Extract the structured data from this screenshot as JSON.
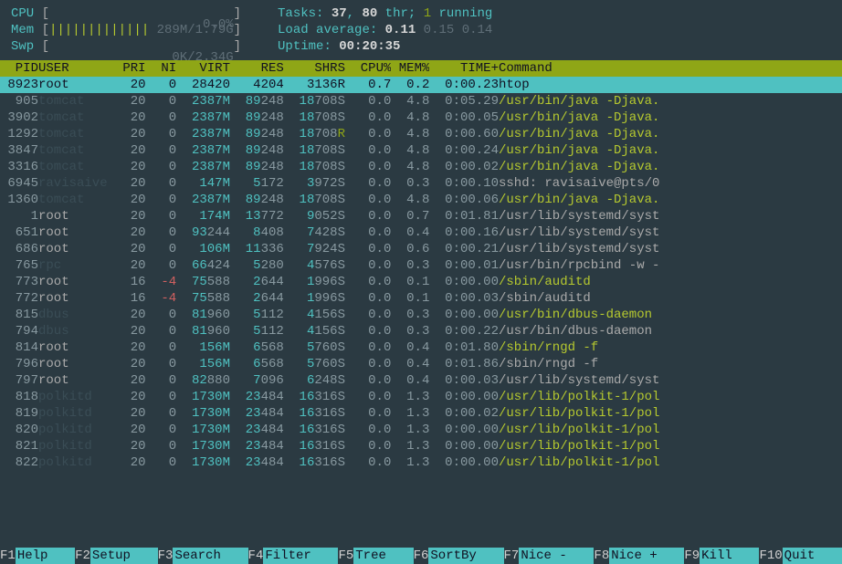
{
  "meters": {
    "cpu": {
      "label": "CPU",
      "bar": "",
      "value": "0.0%"
    },
    "mem": {
      "label": "Mem",
      "bar": "|||||||||||||",
      "value": "289M/1.79G"
    },
    "swp": {
      "label": "Swp",
      "bar": "",
      "value": "0K/2.34G"
    }
  },
  "summary": {
    "tasks_label": "Tasks: ",
    "tasks_n": "37",
    "tasks_sep": ", ",
    "thr_n": "80",
    "thr_suffix": " thr; ",
    "running_n": "1",
    "running_suffix": " running",
    "load_label": "Load average: ",
    "load1": "0.11",
    "load5": "0.15",
    "load15": "0.14",
    "uptime_label": "Uptime: ",
    "uptime": "00:20:35"
  },
  "columns": [
    "PID",
    "USER",
    "PRI",
    "NI",
    "VIRT",
    "RES",
    "SHR",
    "S",
    "CPU%",
    "MEM%",
    "TIME+",
    "Command"
  ],
  "rows": [
    {
      "sel": true,
      "pid": "8923",
      "user": "root",
      "ucol": "root",
      "pri": "20",
      "ni": "0",
      "virt": "28420",
      "res": "4204",
      "shr": "3136",
      "s": "R",
      "cpu": "0.7",
      "mem": "0.2",
      "time": "0:00.23",
      "cmd": "htop",
      "cstyle": "std"
    },
    {
      "pid": "905",
      "user": "tomcat",
      "ucol": "other",
      "pri": "20",
      "ni": "0",
      "virt": "2387M",
      "res": "89248",
      "shr": "18708",
      "s": "S",
      "cpu": "0.0",
      "mem": "4.8",
      "time": "0:05.29",
      "cmd": "/usr/bin/java -Djava.",
      "cstyle": "green"
    },
    {
      "pid": "3902",
      "user": "tomcat",
      "ucol": "other",
      "pri": "20",
      "ni": "0",
      "virt": "2387M",
      "res": "89248",
      "shr": "18708",
      "s": "S",
      "cpu": "0.0",
      "mem": "4.8",
      "time": "0:00.05",
      "cmd": "/usr/bin/java -Djava.",
      "cstyle": "green"
    },
    {
      "pid": "1292",
      "user": "tomcat",
      "ucol": "other",
      "pri": "20",
      "ni": "0",
      "virt": "2387M",
      "res": "89248",
      "shr": "18708",
      "s": "R",
      "cpu": "0.0",
      "mem": "4.8",
      "time": "0:00.60",
      "cmd": "/usr/bin/java -Djava.",
      "cstyle": "green",
      "sflag": "green"
    },
    {
      "pid": "3847",
      "user": "tomcat",
      "ucol": "other",
      "pri": "20",
      "ni": "0",
      "virt": "2387M",
      "res": "89248",
      "shr": "18708",
      "s": "S",
      "cpu": "0.0",
      "mem": "4.8",
      "time": "0:00.24",
      "cmd": "/usr/bin/java -Djava.",
      "cstyle": "green"
    },
    {
      "pid": "3316",
      "user": "tomcat",
      "ucol": "other",
      "pri": "20",
      "ni": "0",
      "virt": "2387M",
      "res": "89248",
      "shr": "18708",
      "s": "S",
      "cpu": "0.0",
      "mem": "4.8",
      "time": "0:00.02",
      "cmd": "/usr/bin/java -Djava.",
      "cstyle": "green"
    },
    {
      "pid": "6945",
      "user": "ravisaive",
      "ucol": "other",
      "pri": "20",
      "ni": "0",
      "virt": "147M",
      "res": "5172",
      "shr": "3972",
      "s": "S",
      "cpu": "0.0",
      "mem": "0.3",
      "time": "0:00.10",
      "cmd": "sshd: ravisaive@pts/0",
      "cstyle": "std"
    },
    {
      "pid": "1360",
      "user": "tomcat",
      "ucol": "other",
      "pri": "20",
      "ni": "0",
      "virt": "2387M",
      "res": "89248",
      "shr": "18708",
      "s": "S",
      "cpu": "0.0",
      "mem": "4.8",
      "time": "0:00.06",
      "cmd": "/usr/bin/java -Djava.",
      "cstyle": "green"
    },
    {
      "pid": "1",
      "user": "root",
      "ucol": "root",
      "pri": "20",
      "ni": "0",
      "virt": "174M",
      "res": "13772",
      "shr": "9052",
      "s": "S",
      "cpu": "0.0",
      "mem": "0.7",
      "time": "0:01.81",
      "cmd": "/usr/lib/systemd/syst",
      "cstyle": "std"
    },
    {
      "pid": "651",
      "user": "root",
      "ucol": "root",
      "pri": "20",
      "ni": "0",
      "virt": "93244",
      "res": "8408",
      "shr": "7428",
      "s": "S",
      "cpu": "0.0",
      "mem": "0.4",
      "time": "0:00.16",
      "cmd": "/usr/lib/systemd/syst",
      "cstyle": "std"
    },
    {
      "pid": "686",
      "user": "root",
      "ucol": "root",
      "pri": "20",
      "ni": "0",
      "virt": "106M",
      "res": "11336",
      "shr": "7924",
      "s": "S",
      "cpu": "0.0",
      "mem": "0.6",
      "time": "0:00.21",
      "cmd": "/usr/lib/systemd/syst",
      "cstyle": "std"
    },
    {
      "pid": "765",
      "user": "rpc",
      "ucol": "other",
      "pri": "20",
      "ni": "0",
      "virt": "66424",
      "res": "5280",
      "shr": "4576",
      "s": "S",
      "cpu": "0.0",
      "mem": "0.3",
      "time": "0:00.01",
      "cmd": "/usr/bin/rpcbind -w -",
      "cstyle": "std"
    },
    {
      "pid": "773",
      "user": "root",
      "ucol": "root",
      "pri": "16",
      "ni": "-4",
      "niflag": "red",
      "virt": "75588",
      "res": "2644",
      "shr": "1996",
      "s": "S",
      "cpu": "0.0",
      "mem": "0.1",
      "time": "0:00.00",
      "cmd": "/sbin/auditd",
      "cstyle": "green"
    },
    {
      "pid": "772",
      "user": "root",
      "ucol": "root",
      "pri": "16",
      "ni": "-4",
      "niflag": "red",
      "virt": "75588",
      "res": "2644",
      "shr": "1996",
      "s": "S",
      "cpu": "0.0",
      "mem": "0.1",
      "time": "0:00.03",
      "cmd": "/sbin/auditd",
      "cstyle": "std"
    },
    {
      "pid": "815",
      "user": "dbus",
      "ucol": "other",
      "pri": "20",
      "ni": "0",
      "virt": "81960",
      "res": "5112",
      "shr": "4156",
      "s": "S",
      "cpu": "0.0",
      "mem": "0.3",
      "time": "0:00.00",
      "cmd": "/usr/bin/dbus-daemon ",
      "cstyle": "green"
    },
    {
      "pid": "794",
      "user": "dbus",
      "ucol": "other",
      "pri": "20",
      "ni": "0",
      "virt": "81960",
      "res": "5112",
      "shr": "4156",
      "s": "S",
      "cpu": "0.0",
      "mem": "0.3",
      "time": "0:00.22",
      "cmd": "/usr/bin/dbus-daemon ",
      "cstyle": "std"
    },
    {
      "pid": "814",
      "user": "root",
      "ucol": "root",
      "pri": "20",
      "ni": "0",
      "virt": "156M",
      "res": "6568",
      "shr": "5760",
      "s": "S",
      "cpu": "0.0",
      "mem": "0.4",
      "time": "0:01.80",
      "cmd": "/sbin/rngd -f",
      "cstyle": "green"
    },
    {
      "pid": "796",
      "user": "root",
      "ucol": "root",
      "pri": "20",
      "ni": "0",
      "virt": "156M",
      "res": "6568",
      "shr": "5760",
      "s": "S",
      "cpu": "0.0",
      "mem": "0.4",
      "time": "0:01.86",
      "cmd": "/sbin/rngd -f",
      "cstyle": "std"
    },
    {
      "pid": "797",
      "user": "root",
      "ucol": "root",
      "pri": "20",
      "ni": "0",
      "virt": "82880",
      "res": "7096",
      "shr": "6248",
      "s": "S",
      "cpu": "0.0",
      "mem": "0.4",
      "time": "0:00.03",
      "cmd": "/usr/lib/systemd/syst",
      "cstyle": "std"
    },
    {
      "pid": "818",
      "user": "polkitd",
      "ucol": "other",
      "pri": "20",
      "ni": "0",
      "virt": "1730M",
      "res": "23484",
      "shr": "16316",
      "s": "S",
      "cpu": "0.0",
      "mem": "1.3",
      "time": "0:00.00",
      "cmd": "/usr/lib/polkit-1/pol",
      "cstyle": "green"
    },
    {
      "pid": "819",
      "user": "polkitd",
      "ucol": "other",
      "pri": "20",
      "ni": "0",
      "virt": "1730M",
      "res": "23484",
      "shr": "16316",
      "s": "S",
      "cpu": "0.0",
      "mem": "1.3",
      "time": "0:00.02",
      "cmd": "/usr/lib/polkit-1/pol",
      "cstyle": "green"
    },
    {
      "pid": "820",
      "user": "polkitd",
      "ucol": "other",
      "pri": "20",
      "ni": "0",
      "virt": "1730M",
      "res": "23484",
      "shr": "16316",
      "s": "S",
      "cpu": "0.0",
      "mem": "1.3",
      "time": "0:00.00",
      "cmd": "/usr/lib/polkit-1/pol",
      "cstyle": "green"
    },
    {
      "pid": "821",
      "user": "polkitd",
      "ucol": "other",
      "pri": "20",
      "ni": "0",
      "virt": "1730M",
      "res": "23484",
      "shr": "16316",
      "s": "S",
      "cpu": "0.0",
      "mem": "1.3",
      "time": "0:00.00",
      "cmd": "/usr/lib/polkit-1/pol",
      "cstyle": "green"
    },
    {
      "pid": "822",
      "user": "polkitd",
      "ucol": "other",
      "pri": "20",
      "ni": "0",
      "virt": "1730M",
      "res": "23484",
      "shr": "16316",
      "s": "S",
      "cpu": "0.0",
      "mem": "1.3",
      "time": "0:00.00",
      "cmd": "/usr/lib/polkit-1/pol",
      "cstyle": "green"
    }
  ],
  "footer": [
    {
      "key": "F1",
      "label": "Help  "
    },
    {
      "key": "F2",
      "label": "Setup "
    },
    {
      "key": "F3",
      "label": "Search"
    },
    {
      "key": "F4",
      "label": "Filter"
    },
    {
      "key": "F5",
      "label": "Tree  "
    },
    {
      "key": "F6",
      "label": "SortBy"
    },
    {
      "key": "F7",
      "label": "Nice -"
    },
    {
      "key": "F8",
      "label": "Nice +"
    },
    {
      "key": "F9",
      "label": "Kill  "
    },
    {
      "key": "F10",
      "label": "Quit  "
    }
  ]
}
